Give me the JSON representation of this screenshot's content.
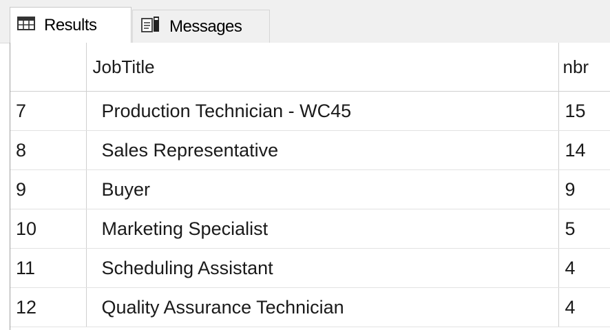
{
  "tabs": {
    "results_label": "Results",
    "messages_label": "Messages",
    "results_icon": "grid-icon",
    "messages_icon": "messages-icon"
  },
  "grid": {
    "columns": [
      "",
      "JobTitle",
      "nbr"
    ],
    "rows": [
      {
        "row": "7",
        "JobTitle": "Production Technician - WC45",
        "nbr": "15"
      },
      {
        "row": "8",
        "JobTitle": "Sales Representative",
        "nbr": "14"
      },
      {
        "row": "9",
        "JobTitle": "Buyer",
        "nbr": "9"
      },
      {
        "row": "10",
        "JobTitle": "Marketing Specialist",
        "nbr": "5"
      },
      {
        "row": "11",
        "JobTitle": "Scheduling Assistant",
        "nbr": "4"
      },
      {
        "row": "12",
        "JobTitle": "Quality Assurance Technician",
        "nbr": "4"
      }
    ]
  },
  "colors": {
    "tab_strip_bg": "#f0f0f0",
    "grid_line": "#cfcfcf",
    "text": "#1a1a1a"
  }
}
